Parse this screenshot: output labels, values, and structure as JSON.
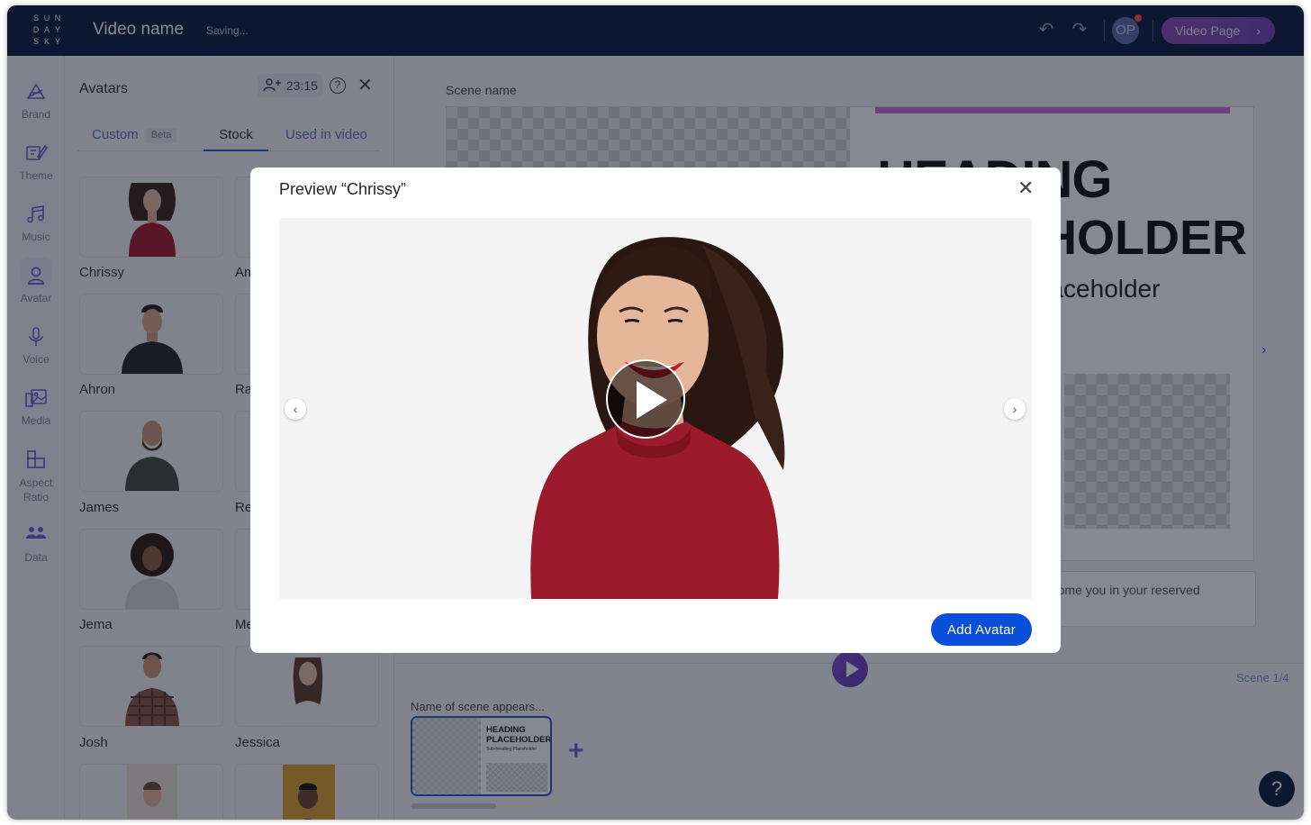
{
  "header": {
    "logo_letters": [
      "S",
      "U",
      "N",
      "D",
      "A",
      "Y",
      "S",
      "K",
      "Y"
    ],
    "video_name": "Video name",
    "save_status": "Saving...",
    "user_initials": "OP",
    "video_page_label": "Video Page",
    "video_page_chevron": "›",
    "undo_glyph": "↶",
    "redo_glyph": "↷"
  },
  "sidebar": {
    "items": [
      {
        "label": "Brand",
        "icon": "brand-icon"
      },
      {
        "label": "Theme",
        "icon": "theme-icon"
      },
      {
        "label": "Music",
        "icon": "music-icon"
      },
      {
        "label": "Avatar",
        "icon": "avatar-icon",
        "active": true
      },
      {
        "label": "Voice",
        "icon": "microphone-icon"
      },
      {
        "label": "Media",
        "icon": "media-icon"
      },
      {
        "label": "Aspect Ratio",
        "icon": "aspect-ratio-icon"
      },
      {
        "label": "Data",
        "icon": "data-icon"
      }
    ]
  },
  "panel": {
    "title": "Avatars",
    "timer": "23:15",
    "help_glyph": "?",
    "close_glyph": "✕",
    "tabs": [
      {
        "label": "Custom",
        "badge": "Beta"
      },
      {
        "label": "Stock",
        "active": true
      },
      {
        "label": "Used in video"
      }
    ],
    "avatars_left": [
      "Chrissy",
      "Ahron",
      "James",
      "Jema",
      "Josh"
    ],
    "avatars_right_partial": [
      "Am",
      "Ra",
      "Re",
      "Me"
    ],
    "avatar_right_full": "Jessica"
  },
  "canvas": {
    "scene_name": "Scene name",
    "heading_line1": "HEADING",
    "heading_line2": "PLACEHOLDER",
    "subheading": "Sub-heading Placeholder",
    "script_text": "We welcome you in your reserved",
    "next_glyph": "›"
  },
  "timeline": {
    "scene_count": "Scene 1/4",
    "scene_caption": "Name of scene appears...",
    "thumb_heading": "HEADING PLACEHOLDER",
    "thumb_sub": "Sub-heading Placeholder",
    "add_glyph": "+"
  },
  "help_glyph": "?",
  "modal": {
    "title": "Preview “Chrissy”",
    "close_glyph": "✕",
    "prev_glyph": "‹",
    "next_glyph": "›",
    "add_button": "Add Avatar"
  },
  "colors": {
    "header_bg": "#0b1a40",
    "accent_blue": "#0a4fd9",
    "accent_purple": "#7a58d6",
    "pink_bar": "#c56fd2",
    "sweater": "#9b1a2b"
  }
}
